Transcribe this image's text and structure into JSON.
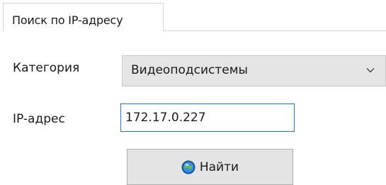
{
  "tabs": {
    "active_label": "Поиск по IP-адресу"
  },
  "form": {
    "category_label": "Категория",
    "category_value": "Видеоподсистемы",
    "ip_label": "IP-адрес",
    "ip_value": "172.17.0.227",
    "find_button_label": "Найти",
    "find_button_icon": "search-globe-icon",
    "dropdown_icon": "chevron-down-icon"
  },
  "colors": {
    "input_focus_border": "#1f77d0",
    "combo_background": "#e5e5e5",
    "button_background": "#e4e4e4"
  }
}
